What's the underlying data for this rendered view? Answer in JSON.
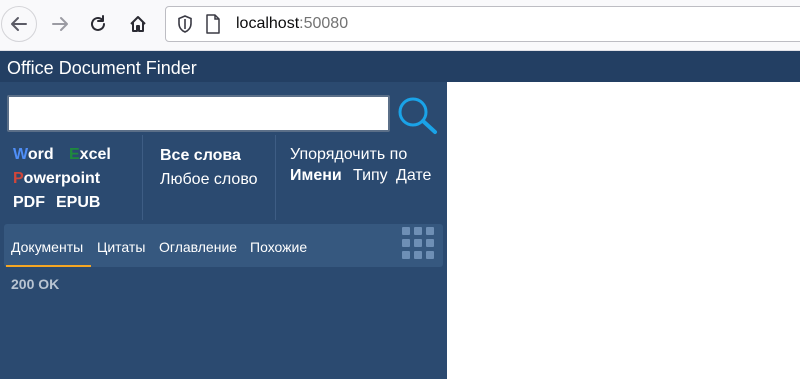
{
  "browser": {
    "url_host": "localhost",
    "url_port": ":50080",
    "icons": [
      "back-icon",
      "forward-icon",
      "reload-icon",
      "home-icon",
      "shield-icon",
      "page-icon"
    ]
  },
  "app": {
    "title": "Office Document Finder",
    "search": {
      "value": "",
      "placeholder": ""
    },
    "file_types": {
      "word": {
        "first": "W",
        "rest": "ord",
        "color": "#4f8ef7"
      },
      "excel": {
        "first": "E",
        "rest": "xcel",
        "color": "#1e8a3c"
      },
      "powerpoint": {
        "first": "P",
        "rest": "owerpoint",
        "color": "#d0463a"
      },
      "pdf": "PDF",
      "epub": "EPUB"
    },
    "match": {
      "all_words": "Все слова",
      "any_word": "Любое слово"
    },
    "sort": {
      "label": "Упорядочить по",
      "by_name": "Имени",
      "by_type": "Типу",
      "by_date": "Дате"
    },
    "tabs": [
      "Документы",
      "Цитаты",
      "Оглавление",
      "Похожие"
    ],
    "active_tab": "Документы",
    "status": "200 OK"
  },
  "colors": {
    "app_background": "#2b4a70",
    "header_background": "#233f63",
    "tab_bar": "#36587f",
    "accent_underline": "#f5a623",
    "search_icon": "#1aa3e8"
  }
}
